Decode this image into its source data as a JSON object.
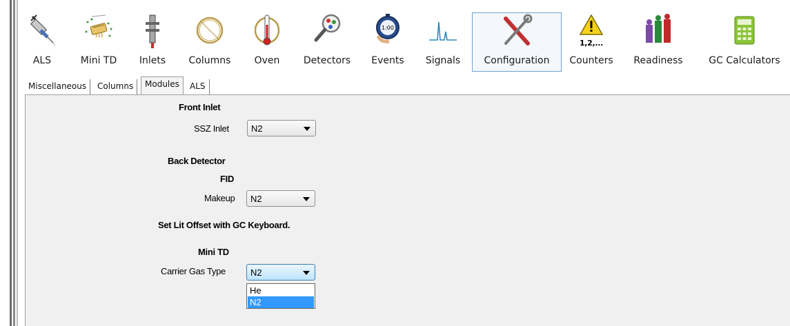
{
  "toolbar": {
    "items": [
      {
        "label": "ALS",
        "icon": "syringe-icon"
      },
      {
        "label": "Mini TD",
        "icon": "thermal-desorber-icon"
      },
      {
        "label": "Inlets",
        "icon": "inlet-icon"
      },
      {
        "label": "Columns",
        "icon": "column-coil-icon"
      },
      {
        "label": "Oven",
        "icon": "oven-icon"
      },
      {
        "label": "Detectors",
        "icon": "magnifier-icon"
      },
      {
        "label": "Events",
        "icon": "stopwatch-icon"
      },
      {
        "label": "Signals",
        "icon": "signal-peak-icon"
      },
      {
        "label": "Configuration",
        "icon": "tools-icon",
        "selected": true
      },
      {
        "label": "Counters",
        "icon": "warning-counter-icon",
        "sublabel": "1,2,..."
      },
      {
        "label": "Readiness",
        "icon": "readiness-bars-icon"
      },
      {
        "label": "GC Calculators",
        "icon": "calculator-icon"
      }
    ],
    "stopwatch_text": "1:00"
  },
  "tabs": [
    {
      "label": "Miscellaneous"
    },
    {
      "label": "Columns"
    },
    {
      "label": "Modules",
      "active": true
    },
    {
      "label": "ALS"
    }
  ],
  "modules": {
    "front_inlet_heading": "Front Inlet",
    "ssz_inlet_label": "SSZ Inlet",
    "ssz_inlet_value": "N2",
    "back_detector_heading": "Back Detector",
    "fid_heading": "FID",
    "makeup_label": "Makeup",
    "makeup_value": "N2",
    "lit_offset_note": "Set Lit Offset with GC Keyboard.",
    "mini_td_heading": "Mini TD",
    "carrier_gas_label": "Carrier Gas  Type",
    "carrier_gas_value": "N2",
    "carrier_gas_options": [
      "He",
      "N2"
    ]
  },
  "colors": {
    "selection": "#3399ff",
    "panel_bg": "#f0f0f0",
    "selected_tool_border": "#6fa0cf"
  }
}
